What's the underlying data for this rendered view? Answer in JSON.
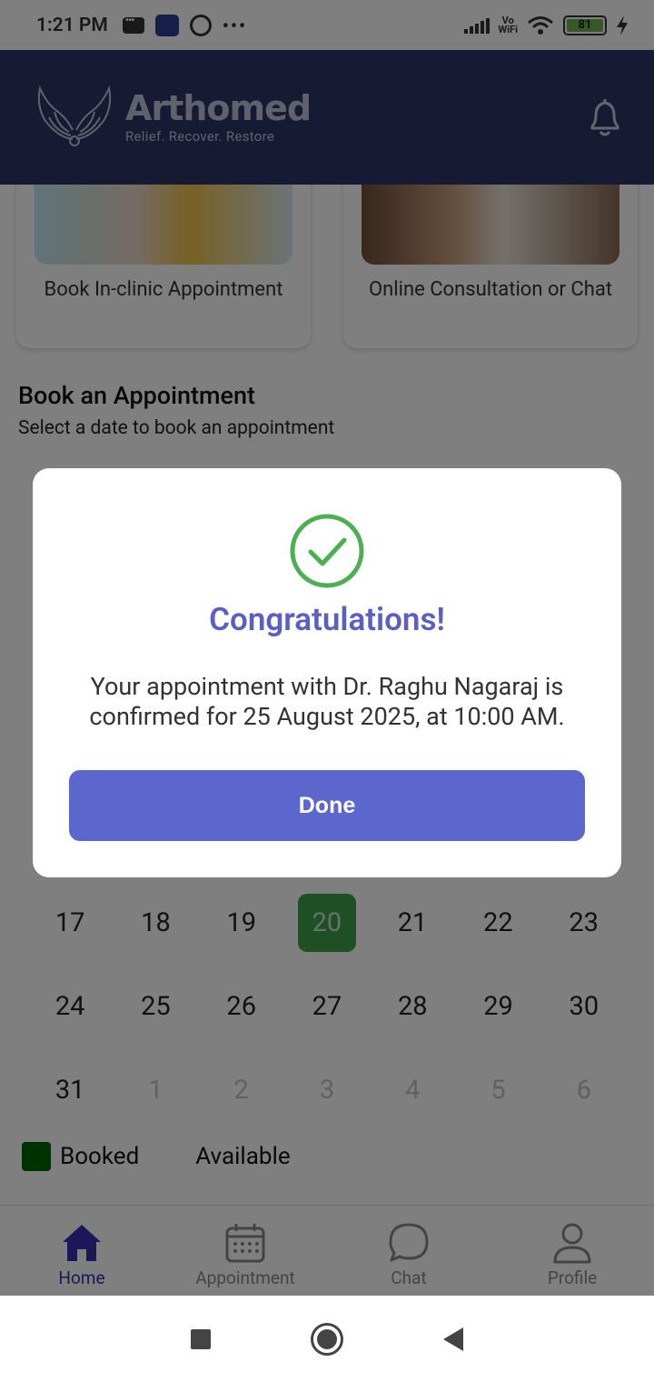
{
  "status_bar": {
    "time": "1:21 PM",
    "vowifi_top": "Vo",
    "vowifi_bottom": "WiFi",
    "battery": "81"
  },
  "header": {
    "brand": "Arthomed",
    "tagline": "Relief. Recover. Restore"
  },
  "services": [
    {
      "label": "Book In-clinic Appointment"
    },
    {
      "label": "Online Consultation or Chat"
    }
  ],
  "booking": {
    "title": "Book an Appointment",
    "subtitle": "Select a date to book an appointment"
  },
  "calendar": {
    "rows": [
      [
        "17",
        "18",
        "19",
        "20",
        "21",
        "22",
        "23"
      ],
      [
        "24",
        "25",
        "26",
        "27",
        "28",
        "29",
        "30"
      ],
      [
        "31",
        "1",
        "2",
        "3",
        "4",
        "5",
        "6"
      ]
    ],
    "booked_day": "20"
  },
  "legend": {
    "booked": "Booked",
    "available": "Available"
  },
  "nav": [
    {
      "label": "Home"
    },
    {
      "label": "Appointment"
    },
    {
      "label": "Chat"
    },
    {
      "label": "Profile"
    }
  ],
  "dialog": {
    "title": "Congratulations!",
    "message": "Your appointment with Dr. Raghu Nagaraj is confirmed for 25 August 2025, at 10:00 AM.",
    "button": "Done"
  },
  "colors": {
    "header_bg": "#2e3466",
    "accent": "#5c67cd",
    "success": "#4caf50",
    "booked": "#006400",
    "nav_active": "#3b2fb4"
  }
}
